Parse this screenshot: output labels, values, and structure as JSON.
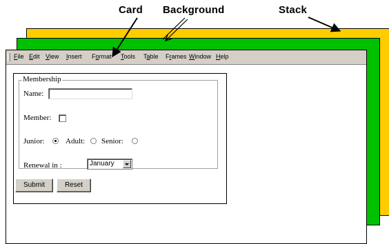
{
  "labels": {
    "card": "Card",
    "background": "Background",
    "stack": "Stack"
  },
  "colors": {
    "stack": "#ffcc00",
    "background": "#00c000",
    "card": "#ffffff",
    "chrome": "#d4d0c8"
  },
  "menu": {
    "items": [
      {
        "pre": "",
        "acc": "F",
        "post": "ile"
      },
      {
        "pre": "",
        "acc": "E",
        "post": "dit"
      },
      {
        "pre": "",
        "acc": "V",
        "post": "iew"
      },
      {
        "pre": "",
        "acc": "I",
        "post": "nsert"
      },
      {
        "pre": "F",
        "acc": "o",
        "post": "rmat"
      },
      {
        "pre": "",
        "acc": "T",
        "post": "ools"
      },
      {
        "pre": "T",
        "acc": "a",
        "post": "ble"
      },
      {
        "pre": "F",
        "acc": "r",
        "post": "ames"
      },
      {
        "pre": "",
        "acc": "W",
        "post": "indow"
      },
      {
        "pre": "",
        "acc": "H",
        "post": "elp"
      }
    ]
  },
  "form": {
    "legend": "Membership",
    "name_label": "Name:",
    "name_value": "",
    "member_label": "Member:",
    "member_checked": false,
    "junior_label": "Junior:",
    "adult_label": "Adult:",
    "senior_label": "Senior:",
    "selected_category": "Junior",
    "renewal_label": "Renewal in :",
    "renewal_value": "January",
    "submit_label": "Submit",
    "reset_label": "Reset"
  }
}
